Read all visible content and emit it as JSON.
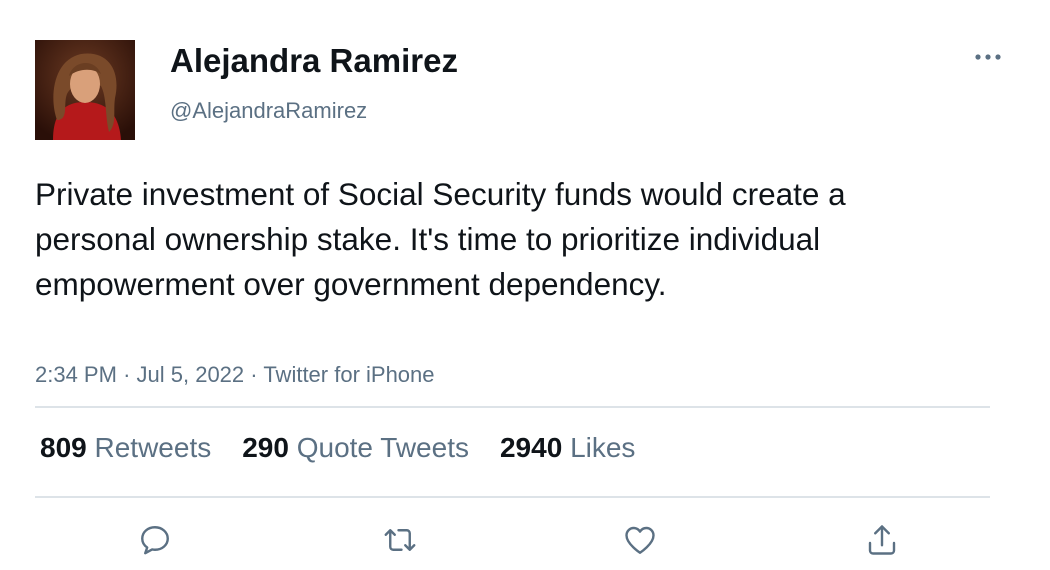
{
  "author": {
    "display_name": "Alejandra Ramirez",
    "handle": "@AlejandraRamirez"
  },
  "tweet": {
    "text": "Private investment of Social Security funds would create a personal ownership stake. It's time to prioritize individual empowerment over government dependency.",
    "time": "2:34 PM",
    "separator": "·",
    "date": "Jul 5, 2022",
    "source": "Twitter for iPhone"
  },
  "stats": {
    "retweets": {
      "count": "809",
      "label": "Retweets"
    },
    "quote_tweets": {
      "count": "290",
      "label": "Quote Tweets"
    },
    "likes": {
      "count": "2940",
      "label": "Likes"
    }
  },
  "actions": {
    "reply_icon": "reply-icon",
    "retweet_icon": "retweet-icon",
    "like_icon": "heart-icon",
    "share_icon": "share-icon",
    "more_icon": "more-horizontal-icon"
  },
  "colors": {
    "text_primary": "#0f1419",
    "text_secondary": "#5b7083",
    "icon": "#5b7083",
    "divider": "#dde3e8"
  }
}
